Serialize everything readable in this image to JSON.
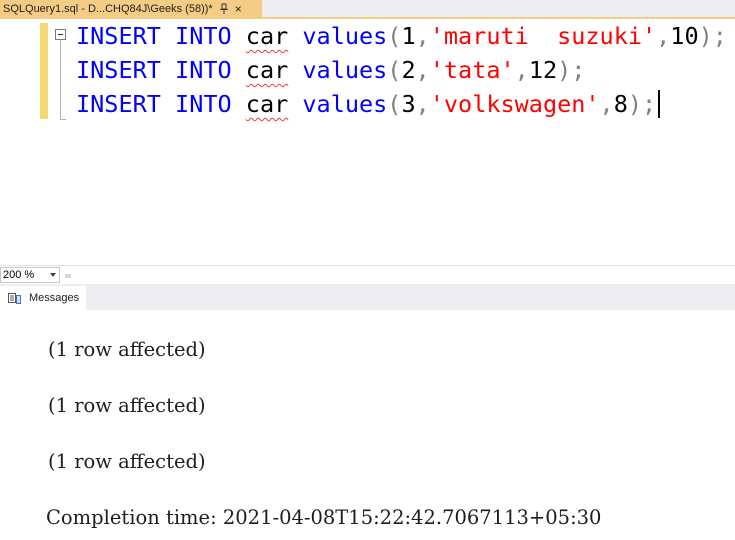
{
  "tab": {
    "title": "SQLQuery1.sql - D...CHQ84J\\Geeks (58))*",
    "close_glyph": "×"
  },
  "editor": {
    "lines": [
      {
        "kw1": "INSERT",
        "kw2": "INTO",
        "table": "car",
        "fn": "values",
        "open": "(",
        "n": "1",
        "c1": ",",
        "str": "'maruti  suzuki'",
        "c2": ",",
        "num": "10",
        "close": ");"
      },
      {
        "kw1": "INSERT",
        "kw2": "INTO",
        "table": "car",
        "fn": "values",
        "open": "(",
        "n": "2",
        "c1": ",",
        "str": "'tata'",
        "c2": ",",
        "num": "12",
        "close": ");"
      },
      {
        "kw1": "INSERT",
        "kw2": "INTO",
        "table": "car",
        "fn": "values",
        "open": "(",
        "n": "3",
        "c1": ",",
        "str": "'volkswagen'",
        "c2": ",",
        "num": "8",
        "close": ");"
      }
    ]
  },
  "zoom": {
    "value": "200 %"
  },
  "results": {
    "tab_label": "Messages"
  },
  "messages": [
    "(1 row affected)",
    "(1 row affected)",
    "(1 row affected)",
    "Completion time: 2021-04-08T15:22:42.7067113+05:30"
  ],
  "colors": {
    "keyword": "#0000ff",
    "string": "#ff0000",
    "punctuation": "#808080",
    "tab_active": "#f5cc84",
    "change_marker": "#f5d774"
  }
}
